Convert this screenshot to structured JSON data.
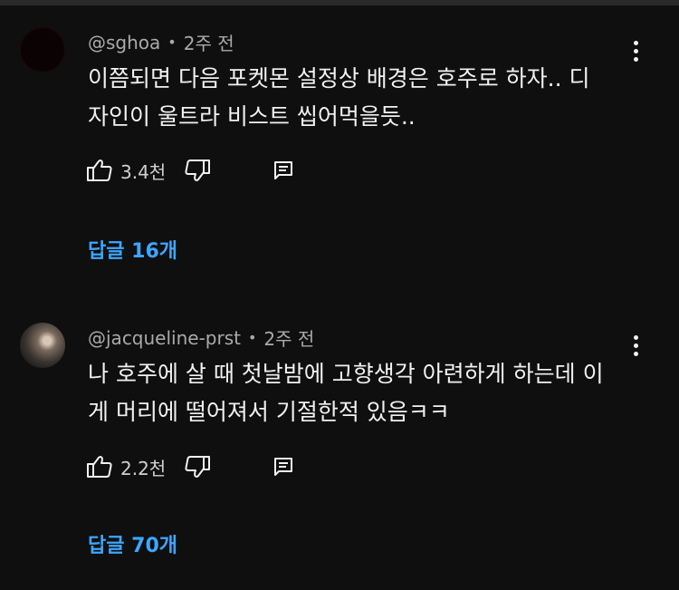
{
  "comments": [
    {
      "author": "@sghoa",
      "separator": "•",
      "time": "2주 전",
      "text_lines": [
        "이쯤되면 다음 포켓몬 설정상 배경은 호주로 하자.. 디",
        "자인이 울트라 비스트 씹어먹을듯.."
      ],
      "likes": "3.4천",
      "replies_label": "답글 16개"
    },
    {
      "author": "@jacqueline-prst",
      "separator": "•",
      "time": "2주 전",
      "text_lines": [
        "나 호주에 살 때 첫날밤에 고향생각 아련하게 하는데 이",
        "게 머리에 떨어져서 기절한적 있음ㅋㅋ"
      ],
      "likes": "2.2천",
      "replies_label": "답글 70개"
    }
  ],
  "colors": {
    "background": "#0f0f0f",
    "text": "#f1f1f1",
    "meta": "#aaaaaa",
    "link": "#3ea6ff"
  },
  "icons": [
    "like-icon",
    "dislike-icon",
    "reply-icon",
    "more-vert-icon"
  ]
}
